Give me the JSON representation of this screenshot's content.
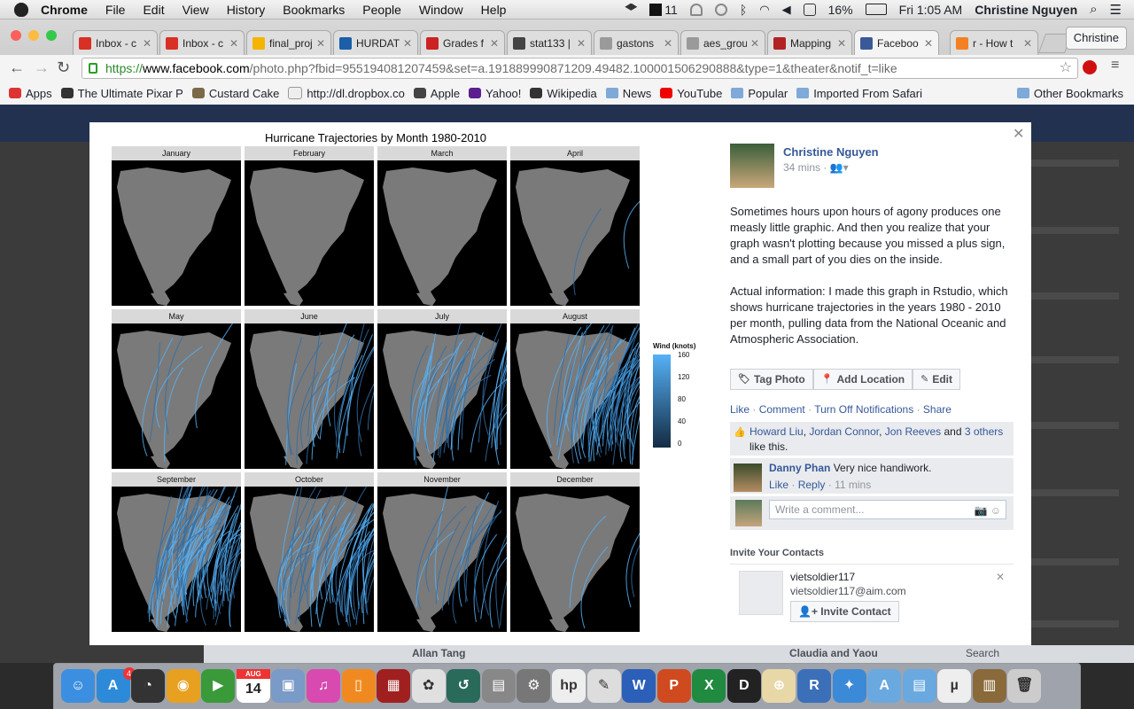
{
  "menubar": {
    "app": "Chrome",
    "menus": [
      "File",
      "Edit",
      "View",
      "History",
      "Bookmarks",
      "People",
      "Window",
      "Help"
    ],
    "status_badge": "11",
    "battery": "16%",
    "clock": "Fri 1:05 AM",
    "user": "Christine Nguyen"
  },
  "tabs": [
    {
      "label": "Inbox - c",
      "favicon": "gmail-icon",
      "color": "#d93025"
    },
    {
      "label": "Inbox - c",
      "favicon": "gmail-icon",
      "color": "#d93025"
    },
    {
      "label": "final_proj",
      "favicon": "slides-icon",
      "color": "#f4b400"
    },
    {
      "label": "HURDAT",
      "favicon": "noaa-icon",
      "color": "#1a5fa8"
    },
    {
      "label": "Grades f",
      "favicon": "grades-icon",
      "color": "#cc2222"
    },
    {
      "label": "stat133 |",
      "favicon": "github-icon",
      "color": "#444444"
    },
    {
      "label": "gastons",
      "favicon": "doc-icon",
      "color": "#9a9a9a"
    },
    {
      "label": "aes_grou",
      "favicon": "doc-icon",
      "color": "#9a9a9a"
    },
    {
      "label": "Mapping",
      "favicon": "zotero-icon",
      "color": "#b22222"
    },
    {
      "label": "Faceboo",
      "favicon": "facebook-icon",
      "color": "#3b5998"
    },
    {
      "label": "r - How t",
      "favicon": "stackoverflow-icon",
      "color": "#f48024"
    }
  ],
  "profile_button": "Christine",
  "url": {
    "scheme": "https://",
    "host": "www.facebook.com",
    "path": "/photo.php?fbid=955194081207459&set=a.191889990871209.49482.100001506290888&type=1&theater&notif_t=like"
  },
  "bookmarks": [
    {
      "label": "Apps",
      "icon": "apps-grid-icon"
    },
    {
      "label": "The Ultimate Pixar P",
      "icon": "pixar-icon"
    },
    {
      "label": "Custard Cake",
      "icon": "image-icon"
    },
    {
      "label": "http://dl.dropbox.co",
      "icon": "page-icon"
    },
    {
      "label": "Apple",
      "icon": "apple-icon"
    },
    {
      "label": "Yahoo!",
      "icon": "yahoo-icon"
    },
    {
      "label": "Wikipedia",
      "icon": "wikipedia-icon"
    },
    {
      "label": "News",
      "icon": "folder-icon"
    },
    {
      "label": "YouTube",
      "icon": "youtube-icon"
    },
    {
      "label": "Popular",
      "icon": "folder-icon"
    },
    {
      "label": "Imported From Safari",
      "icon": "folder-icon"
    },
    {
      "label": "Other Bookmarks",
      "icon": "folder-icon"
    }
  ],
  "photo": {
    "title": "Hurricane Trajectories by Month 1980-2010",
    "months": [
      "January",
      "February",
      "March",
      "April",
      "May",
      "June",
      "July",
      "August",
      "September",
      "October",
      "November",
      "December"
    ],
    "track_density": [
      0,
      0,
      0,
      2,
      6,
      22,
      40,
      60,
      75,
      55,
      18,
      4
    ],
    "legend_title": "Wind (knots)",
    "legend_ticks": [
      "160",
      "120",
      "80",
      "40",
      "0"
    ],
    "colors": {
      "low": "#132b43",
      "high": "#56b1f7",
      "land": "#7a7a7a",
      "sea": "#000000"
    }
  },
  "post": {
    "author": "Christine Nguyen",
    "time": "34 mins",
    "audience_icon": "friends-icon",
    "caption_p1": "Sometimes hours upon hours of agony produces one measly little graphic. And then you realize that your graph wasn't plotting because you missed a plus sign, and a small part of you dies on the inside.",
    "caption_p2": "Actual information: I made this graph in Rstudio, which shows hurricane trajectories in the years 1980 - 2010 per month, pulling data from the National Oceanic and Atmospheric Association.",
    "buttons": {
      "tag": "Tag Photo",
      "location": "Add Location",
      "edit": "Edit"
    },
    "actions": {
      "like": "Like",
      "comment": "Comment",
      "notifications": "Turn Off Notifications",
      "share": "Share"
    },
    "likes": {
      "n1": "Howard Liu",
      "n2": "Jordan Connor",
      "n3": "Jon Reeves",
      "and": "and",
      "others": "3 others",
      "tail": "like this."
    },
    "comment": {
      "author": "Danny Phan",
      "text": "Very nice handiwork.",
      "like": "Like",
      "reply": "Reply",
      "time": "11 mins"
    },
    "write_placeholder": "Write a comment..."
  },
  "invite": {
    "heading": "Invite Your Contacts",
    "name": "vietsoldier117",
    "email": "vietsoldier117@aim.com",
    "button": "Invite Contact"
  },
  "chatbar": {
    "left": "Allan Tang",
    "mid": "Claudia and Yaou",
    "search": "Search"
  },
  "dock": {
    "calendar_month": "AUG",
    "calendar_day": "14",
    "appstore_badge": "4"
  }
}
